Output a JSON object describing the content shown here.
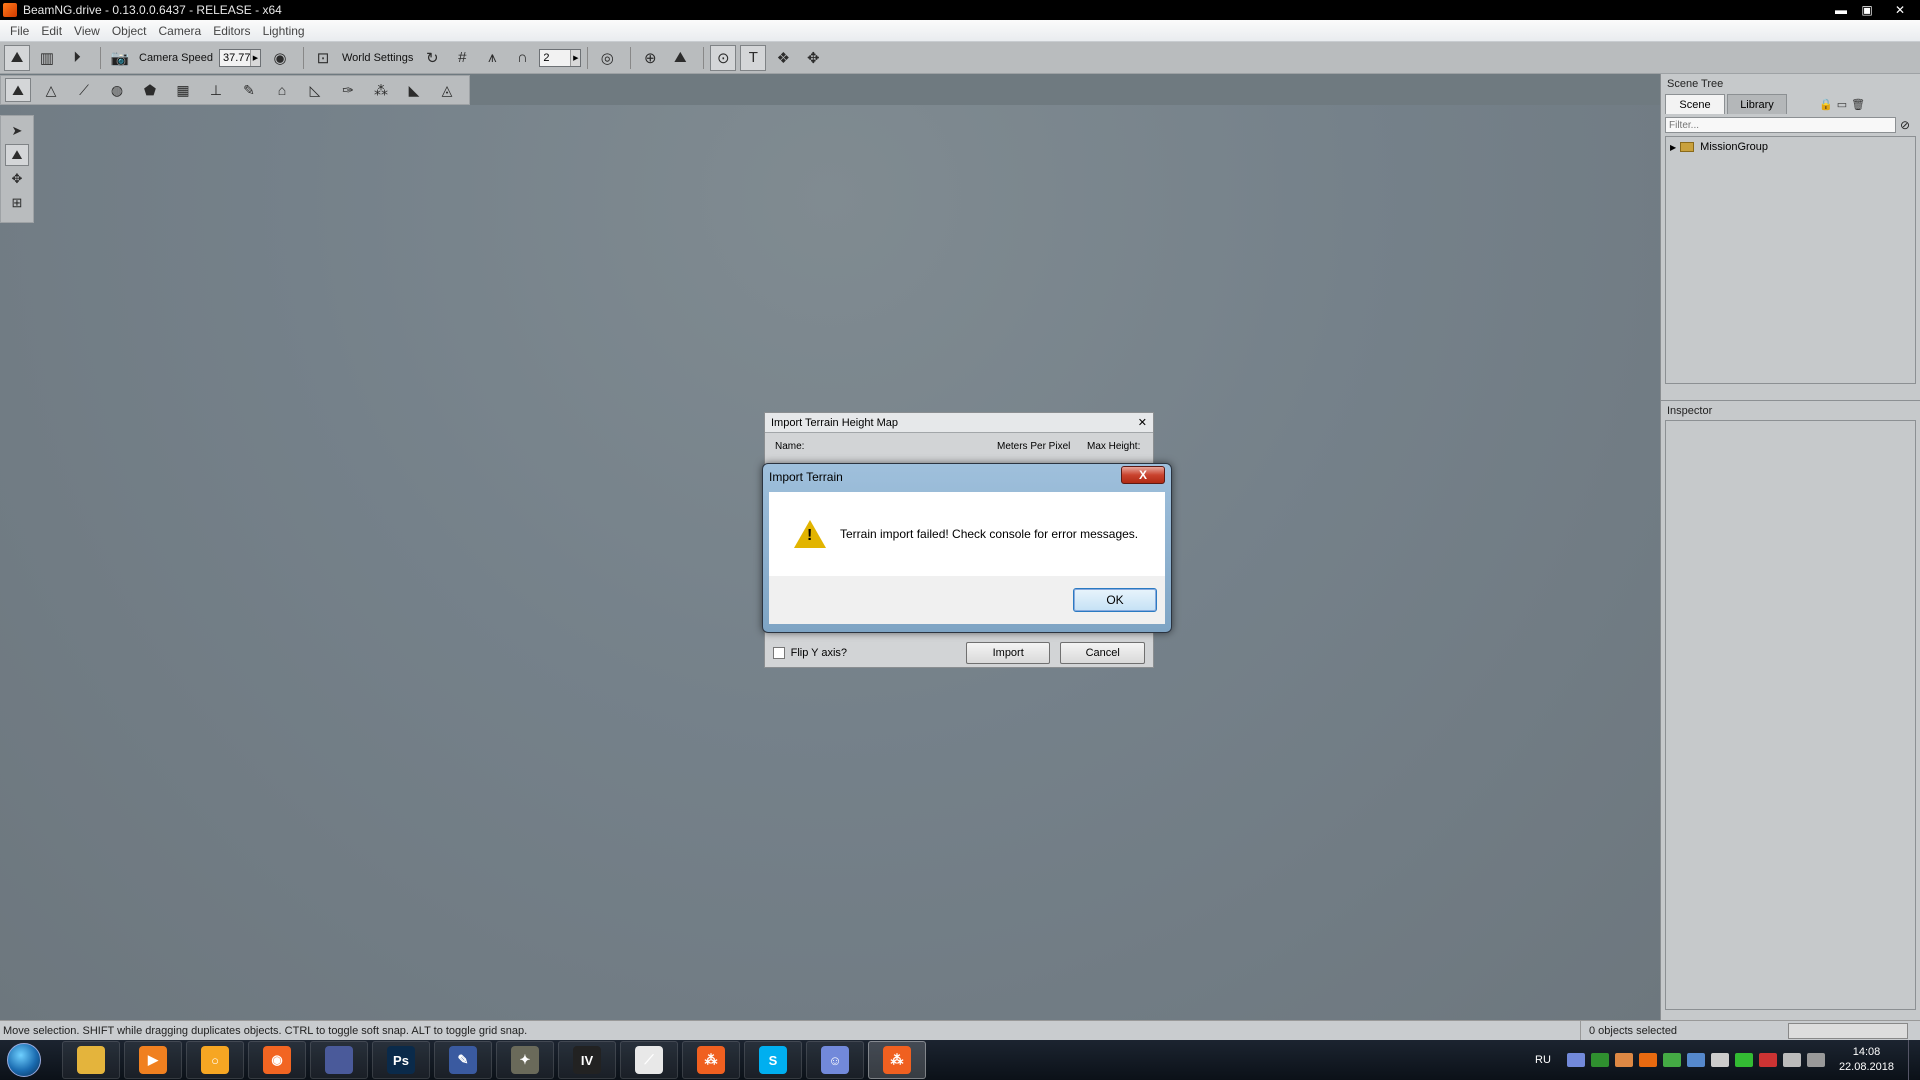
{
  "window": {
    "title": "BeamNG.drive - 0.13.0.0.6437 - RELEASE - x64",
    "minimize": "▬",
    "restore": "▣",
    "close": "✕"
  },
  "menu": [
    "File",
    "Edit",
    "View",
    "Object",
    "Camera",
    "Editors",
    "Lighting"
  ],
  "toolbar": {
    "camera_speed_label": "Camera Speed",
    "camera_speed_value": "37.773",
    "world_settings_label": "World Settings",
    "snap_value": "2"
  },
  "scene_panel": {
    "title": "Scene Tree",
    "tabs": [
      "Scene",
      "Library"
    ],
    "filter_placeholder": "Filter...",
    "tree_items": [
      "MissionGroup"
    ]
  },
  "inspector": {
    "title": "Inspector"
  },
  "status": {
    "text": "Move selection.  SHIFT while dragging duplicates objects.  CTRL to toggle soft snap.  ALT to toggle grid snap.",
    "selected": "0 objects selected"
  },
  "import_dialog": {
    "title": "Import Terrain Height Map",
    "close": "✕",
    "name_label": "Name:",
    "meters_label": "Meters Per Pixel",
    "max_height_label": "Max Height:",
    "flip_label": "Flip Y axis?",
    "import_button": "Import",
    "cancel_button": "Cancel"
  },
  "alert": {
    "title": "Import Terrain",
    "close": "X",
    "message": "Terrain import failed! Check console for error messages.",
    "ok": "OK"
  },
  "taskbar": {
    "language": "RU",
    "time": "14:08",
    "date": "22.08.2018",
    "apps": [
      {
        "name": "explorer",
        "color": "#e4b43c",
        "glyph": ""
      },
      {
        "name": "media-player",
        "color": "#f08020",
        "glyph": "▶"
      },
      {
        "name": "browser",
        "color": "#f6a623",
        "glyph": "○"
      },
      {
        "name": "origin",
        "color": "#f26522",
        "glyph": "◉"
      },
      {
        "name": "app-blue",
        "color": "#4a5a9a",
        "glyph": ""
      },
      {
        "name": "photoshop",
        "color": "#0a2a4a",
        "glyph": "Ps"
      },
      {
        "name": "app-editor",
        "color": "#3a5aa0",
        "glyph": "✎"
      },
      {
        "name": "gimp",
        "color": "#6a6a5a",
        "glyph": "✦"
      },
      {
        "name": "gta-iv",
        "color": "#222",
        "glyph": "IV"
      },
      {
        "name": "forza",
        "color": "#e8e8e8",
        "glyph": "⟋"
      },
      {
        "name": "beam-app",
        "color": "#f06020",
        "glyph": "⁂"
      },
      {
        "name": "skype",
        "color": "#00aff0",
        "glyph": "S"
      },
      {
        "name": "discord",
        "color": "#7289da",
        "glyph": "☺"
      },
      {
        "name": "beamng",
        "color": "#f06020",
        "glyph": "⁂"
      }
    ]
  }
}
